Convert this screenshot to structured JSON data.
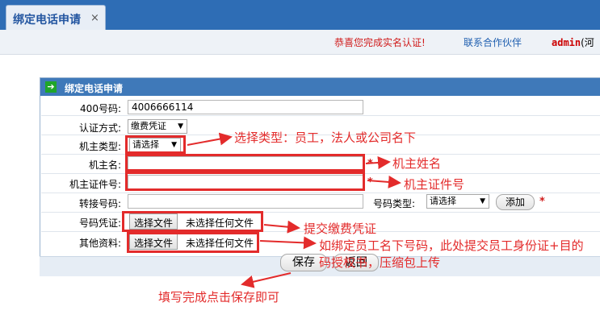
{
  "tab": {
    "title": "绑定电话申请",
    "close": "×"
  },
  "topbar": {
    "congrats": "恭喜您完成实名认证!",
    "partners": "联系合作伙伴",
    "user": "admin",
    "user_suffix": "(河"
  },
  "panel": {
    "title": "绑定电话申请"
  },
  "form": {
    "num400_label": "400号码:",
    "num400_value": "4006666114",
    "auth_label": "认证方式:",
    "auth_value": "缴费凭证",
    "owner_type_label": "机主类型:",
    "owner_type_value": "请选择",
    "owner_name_label": "机主名:",
    "owner_id_label": "机主证件号:",
    "transfer_label": "转接号码:",
    "num_type_label": "号码类型:",
    "num_type_value": "请选择",
    "add_label": "添加",
    "voucher_label": "号码凭证:",
    "other_label": "其他资料:",
    "choose_file": "选择文件",
    "no_file": "未选择任何文件",
    "save_label": "保存",
    "back_label": "返回",
    "required": "*"
  },
  "annotations": {
    "select_type": "选择类型：员工，法人或公司名下",
    "owner_name": "机主姓名",
    "owner_id": "机主证件号",
    "submit_voucher": "提交缴费凭证",
    "other_line1": "如绑定员工名下号码，此处提交员工身份证+目的",
    "other_line2": "码授权书，压缩包上传",
    "save_hint": "填写完成点击保存即可"
  },
  "colors": {
    "header_blue": "#2e6db5",
    "panel_head": "#3f79b9",
    "annotation_red": "#e32b2b"
  }
}
